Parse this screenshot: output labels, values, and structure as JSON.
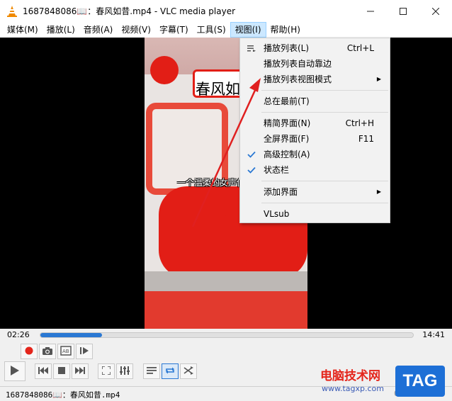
{
  "window": {
    "title": "1687848086📖：春风如昔.mp4 - VLC media player",
    "minimize_glyph": "—",
    "maximize_glyph": "☐",
    "close_glyph": "✕"
  },
  "menubar": {
    "items": [
      {
        "label": "媒体(M)"
      },
      {
        "label": "播放(L)"
      },
      {
        "label": "音频(A)"
      },
      {
        "label": "视频(V)"
      },
      {
        "label": "字幕(T)"
      },
      {
        "label": "工具(S)"
      },
      {
        "label": "视图(I)",
        "active": true
      },
      {
        "label": "帮助(H)"
      }
    ]
  },
  "view_menu": {
    "items": [
      {
        "label": "播放列表(L)",
        "shortcut": "Ctrl+L",
        "icon": "playlist-icon"
      },
      {
        "label": "播放列表自动靠边",
        "shortcut": ""
      },
      {
        "label": "播放列表视图模式",
        "submenu": true
      },
      {
        "separator": true
      },
      {
        "label": "总在最前(T)"
      },
      {
        "separator": true
      },
      {
        "label": "精简界面(N)",
        "shortcut": "Ctrl+H"
      },
      {
        "label": "全屏界面(F)",
        "shortcut": "F11"
      },
      {
        "label": "高级控制(A)",
        "checked": true
      },
      {
        "label": "状态栏",
        "checked": true
      },
      {
        "separator": true
      },
      {
        "label": "添加界面",
        "submenu": true
      },
      {
        "separator": true
      },
      {
        "label": "VLsub"
      }
    ]
  },
  "video": {
    "overlay_title": "春风如",
    "subtitle": "一个温柔的女声使"
  },
  "player": {
    "elapsed": "02:26",
    "total": "14:41",
    "progress_percent": 16.6
  },
  "status": {
    "filename": "1687848086📖：春风如昔.mp4",
    "time": "02:26/14:41"
  },
  "watermark": {
    "text": "电脑技术网",
    "url": "www.tagxp.com",
    "badge": "TAG"
  },
  "colors": {
    "accent": "#2a78d3",
    "record": "#e4251b",
    "annotation_arrow": "#e02020"
  }
}
